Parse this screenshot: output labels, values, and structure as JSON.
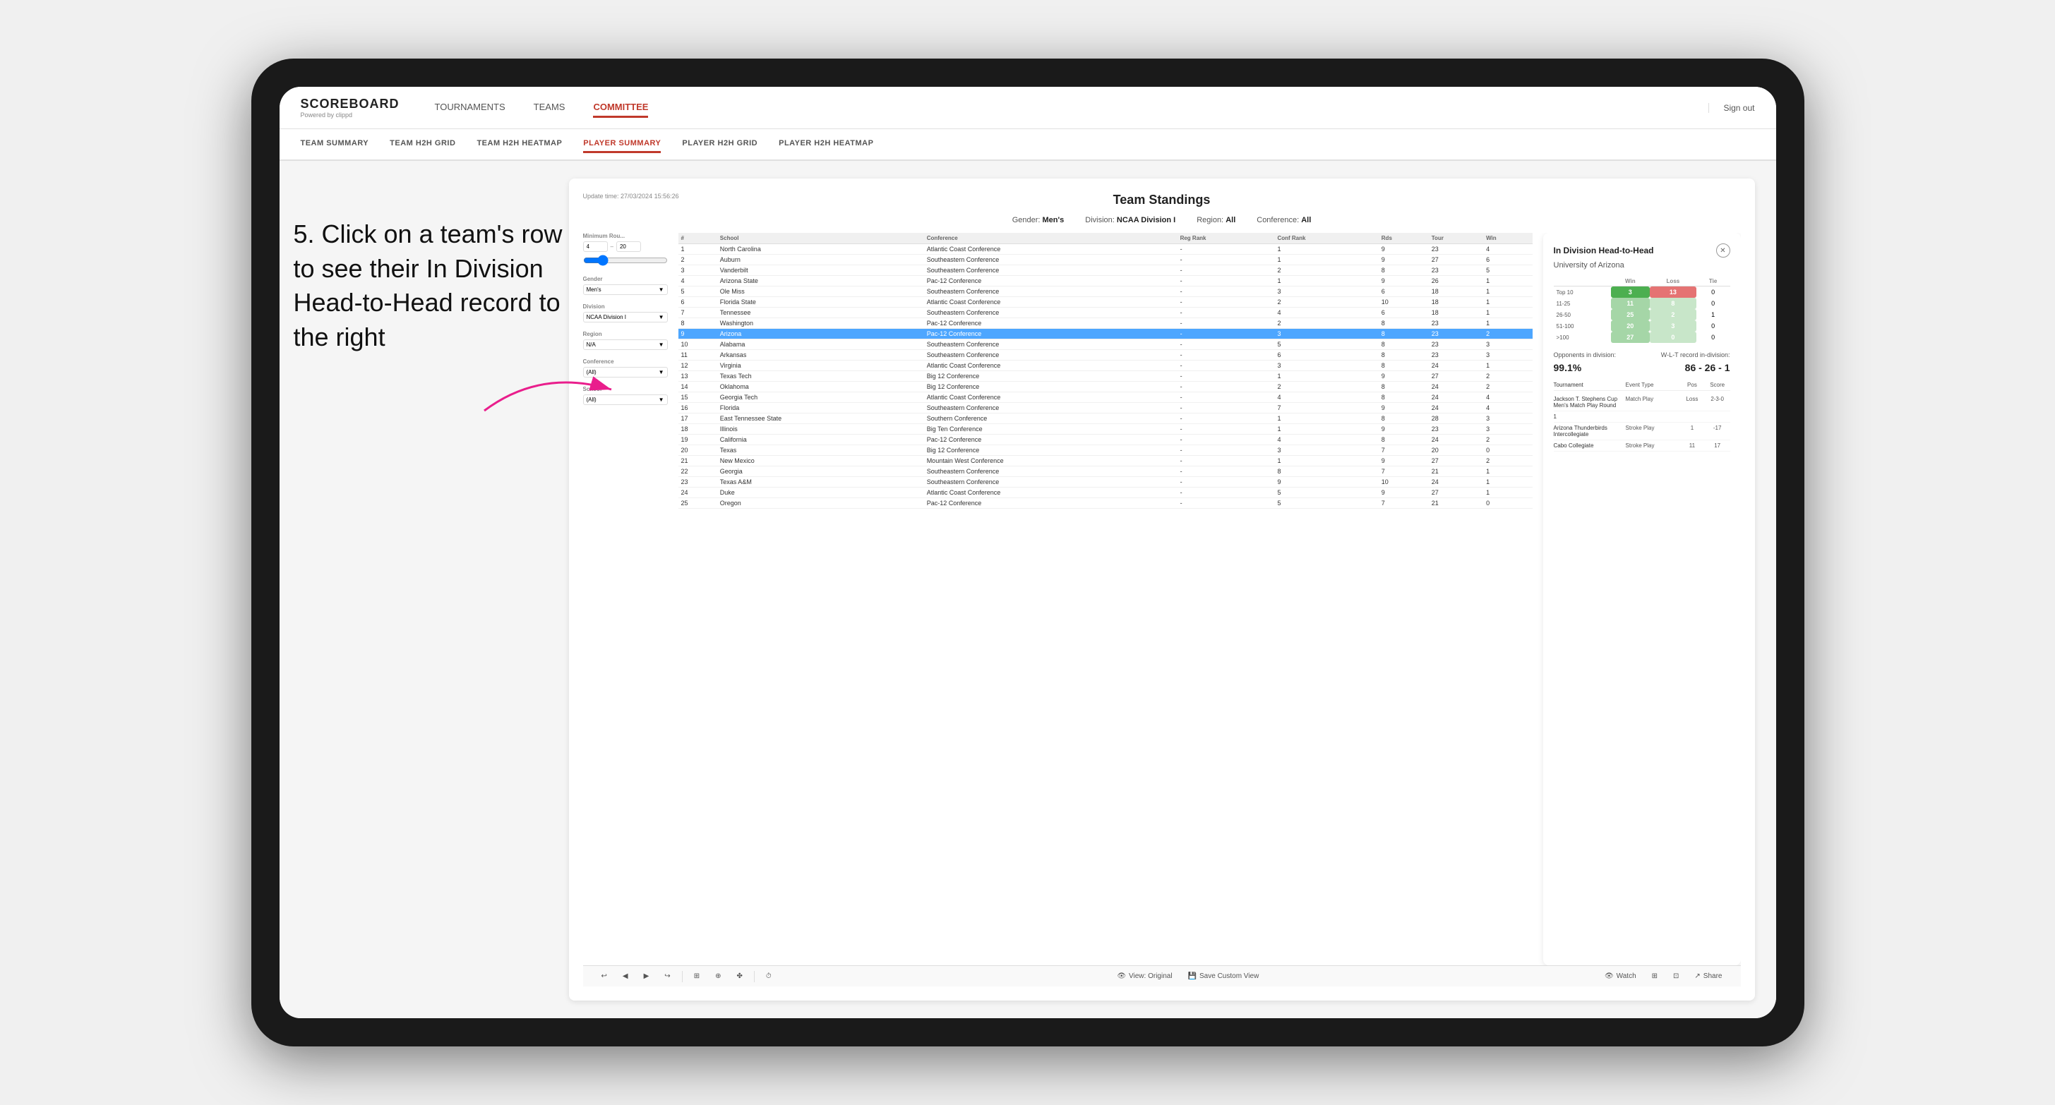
{
  "annotation": {
    "text": "5. Click on a team's row to see their In Division Head-to-Head record to the right"
  },
  "logo": {
    "title": "SCOREBOARD",
    "subtitle": "Powered by clippd"
  },
  "top_nav": {
    "links": [
      "TOURNAMENTS",
      "TEAMS",
      "COMMITTEE"
    ],
    "active": "COMMITTEE",
    "sign_out": "Sign out"
  },
  "sub_nav": {
    "links": [
      "TEAM SUMMARY",
      "TEAM H2H GRID",
      "TEAM H2H HEATMAP",
      "PLAYER SUMMARY",
      "PLAYER H2H GRID",
      "PLAYER H2H HEATMAP"
    ],
    "active": "PLAYER SUMMARY"
  },
  "panel": {
    "update_time": "Update time: 27/03/2024 15:56:26",
    "title": "Team Standings",
    "filters": {
      "gender": "Men's",
      "division": "NCAA Division I",
      "region": "All",
      "conference": "All"
    },
    "min_rounds_label": "Minimum Rou...",
    "min_rounds_value": "4",
    "min_rounds_max": "20",
    "gender_label": "Gender",
    "gender_value": "Men's",
    "division_label": "Division",
    "division_value": "NCAA Division I",
    "region_label": "Region",
    "region_value": "N/A",
    "conference_label": "Conference",
    "conference_value": "(All)",
    "school_label": "School",
    "school_value": "(All)",
    "table_headers": [
      "#",
      "School",
      "Conference",
      "Reg Rank",
      "Conf Rank",
      "Rds",
      "Tour",
      "Win"
    ],
    "rows": [
      {
        "num": 1,
        "school": "North Carolina",
        "conf": "Atlantic Coast Conference",
        "reg": "-",
        "crank": 1,
        "rds": 9,
        "tour": 23,
        "win": 4
      },
      {
        "num": 2,
        "school": "Auburn",
        "conf": "Southeastern Conference",
        "reg": "-",
        "crank": 1,
        "rds": 9,
        "tour": 27,
        "win": 6
      },
      {
        "num": 3,
        "school": "Vanderbilt",
        "conf": "Southeastern Conference",
        "reg": "-",
        "crank": 2,
        "rds": 8,
        "tour": 23,
        "win": 5
      },
      {
        "num": 4,
        "school": "Arizona State",
        "conf": "Pac-12 Conference",
        "reg": "-",
        "crank": 1,
        "rds": 9,
        "tour": 26,
        "win": 1
      },
      {
        "num": 5,
        "school": "Ole Miss",
        "conf": "Southeastern Conference",
        "reg": "-",
        "crank": 3,
        "rds": 6,
        "tour": 18,
        "win": 1
      },
      {
        "num": 6,
        "school": "Florida State",
        "conf": "Atlantic Coast Conference",
        "reg": "-",
        "crank": 2,
        "rds": 10,
        "tour": 18,
        "win": 1
      },
      {
        "num": 7,
        "school": "Tennessee",
        "conf": "Southeastern Conference",
        "reg": "-",
        "crank": 4,
        "rds": 6,
        "tour": 18,
        "win": 1
      },
      {
        "num": 8,
        "school": "Washington",
        "conf": "Pac-12 Conference",
        "reg": "-",
        "crank": 2,
        "rds": 8,
        "tour": 23,
        "win": 1
      },
      {
        "num": 9,
        "school": "Arizona",
        "conf": "Pac-12 Conference",
        "reg": "-",
        "crank": 3,
        "rds": 8,
        "tour": 23,
        "win": 2,
        "selected": true
      },
      {
        "num": 10,
        "school": "Alabama",
        "conf": "Southeastern Conference",
        "reg": "-",
        "crank": 5,
        "rds": 8,
        "tour": 23,
        "win": 3
      },
      {
        "num": 11,
        "school": "Arkansas",
        "conf": "Southeastern Conference",
        "reg": "-",
        "crank": 6,
        "rds": 8,
        "tour": 23,
        "win": 3
      },
      {
        "num": 12,
        "school": "Virginia",
        "conf": "Atlantic Coast Conference",
        "reg": "-",
        "crank": 3,
        "rds": 8,
        "tour": 24,
        "win": 1
      },
      {
        "num": 13,
        "school": "Texas Tech",
        "conf": "Big 12 Conference",
        "reg": "-",
        "crank": 1,
        "rds": 9,
        "tour": 27,
        "win": 2
      },
      {
        "num": 14,
        "school": "Oklahoma",
        "conf": "Big 12 Conference",
        "reg": "-",
        "crank": 2,
        "rds": 8,
        "tour": 24,
        "win": 2
      },
      {
        "num": 15,
        "school": "Georgia Tech",
        "conf": "Atlantic Coast Conference",
        "reg": "-",
        "crank": 4,
        "rds": 8,
        "tour": 24,
        "win": 4
      },
      {
        "num": 16,
        "school": "Florida",
        "conf": "Southeastern Conference",
        "reg": "-",
        "crank": 7,
        "rds": 9,
        "tour": 24,
        "win": 4
      },
      {
        "num": 17,
        "school": "East Tennessee State",
        "conf": "Southern Conference",
        "reg": "-",
        "crank": 1,
        "rds": 8,
        "tour": 28,
        "win": 3
      },
      {
        "num": 18,
        "school": "Illinois",
        "conf": "Big Ten Conference",
        "reg": "-",
        "crank": 1,
        "rds": 9,
        "tour": 23,
        "win": 3
      },
      {
        "num": 19,
        "school": "California",
        "conf": "Pac-12 Conference",
        "reg": "-",
        "crank": 4,
        "rds": 8,
        "tour": 24,
        "win": 2
      },
      {
        "num": 20,
        "school": "Texas",
        "conf": "Big 12 Conference",
        "reg": "-",
        "crank": 3,
        "rds": 7,
        "tour": 20,
        "win": 0
      },
      {
        "num": 21,
        "school": "New Mexico",
        "conf": "Mountain West Conference",
        "reg": "-",
        "crank": 1,
        "rds": 9,
        "tour": 27,
        "win": 2
      },
      {
        "num": 22,
        "school": "Georgia",
        "conf": "Southeastern Conference",
        "reg": "-",
        "crank": 8,
        "rds": 7,
        "tour": 21,
        "win": 1
      },
      {
        "num": 23,
        "school": "Texas A&M",
        "conf": "Southeastern Conference",
        "reg": "-",
        "crank": 9,
        "rds": 10,
        "tour": 24,
        "win": 1
      },
      {
        "num": 24,
        "school": "Duke",
        "conf": "Atlantic Coast Conference",
        "reg": "-",
        "crank": 5,
        "rds": 9,
        "tour": 27,
        "win": 1
      },
      {
        "num": 25,
        "school": "Oregon",
        "conf": "Pac-12 Conference",
        "reg": "-",
        "crank": 5,
        "rds": 7,
        "tour": 21,
        "win": 0
      }
    ]
  },
  "h2h": {
    "title": "In Division Head-to-Head",
    "school": "University of Arizona",
    "table_headers": [
      "",
      "Win",
      "Loss",
      "Tie"
    ],
    "rows": [
      {
        "label": "Top 10",
        "win": 3,
        "loss": 13,
        "tie": 0,
        "win_color": "green",
        "loss_color": "red"
      },
      {
        "label": "11-25",
        "win": 11,
        "loss": 8,
        "tie": 0,
        "win_color": "lightgreen",
        "loss_color": "lightyellow"
      },
      {
        "label": "26-50",
        "win": 25,
        "loss": 2,
        "tie": 1,
        "win_color": "lightgreen",
        "loss_color": "lightyellow"
      },
      {
        "label": "51-100",
        "win": 20,
        "loss": 3,
        "tie": 0,
        "win_color": "lightgreen",
        "loss_color": "lightyellow"
      },
      {
        "label": ">100",
        "win": 27,
        "loss": 0,
        "tie": 0,
        "win_color": "lightgreen",
        "loss_color": "lightyellow"
      }
    ],
    "opponents_label": "Opponents in division:",
    "opponents_value": "99.1%",
    "record_label": "W-L-T record in-division:",
    "record_value": "86 - 26 - 1",
    "tournament_headers": [
      "Tournament",
      "Event Type",
      "Pos",
      "Score"
    ],
    "tournaments": [
      {
        "name": "Jackson T. Stephens Cup Men's Match Play Round",
        "type": "Match Play",
        "pos": "Loss",
        "score": "2-3-0"
      },
      {
        "name": "1",
        "type": "",
        "pos": "",
        "score": ""
      },
      {
        "name": "Arizona Thunderbirds Intercollegiate",
        "type": "Stroke Play",
        "pos": "1",
        "score": "-17"
      },
      {
        "name": "Cabo Collegiate",
        "type": "Stroke Play",
        "pos": "11",
        "score": "17"
      }
    ]
  },
  "toolbar": {
    "undo": "↩",
    "redo": "↪",
    "view_original": "View: Original",
    "save_custom": "Save Custom View",
    "watch": "Watch",
    "share": "Share"
  }
}
